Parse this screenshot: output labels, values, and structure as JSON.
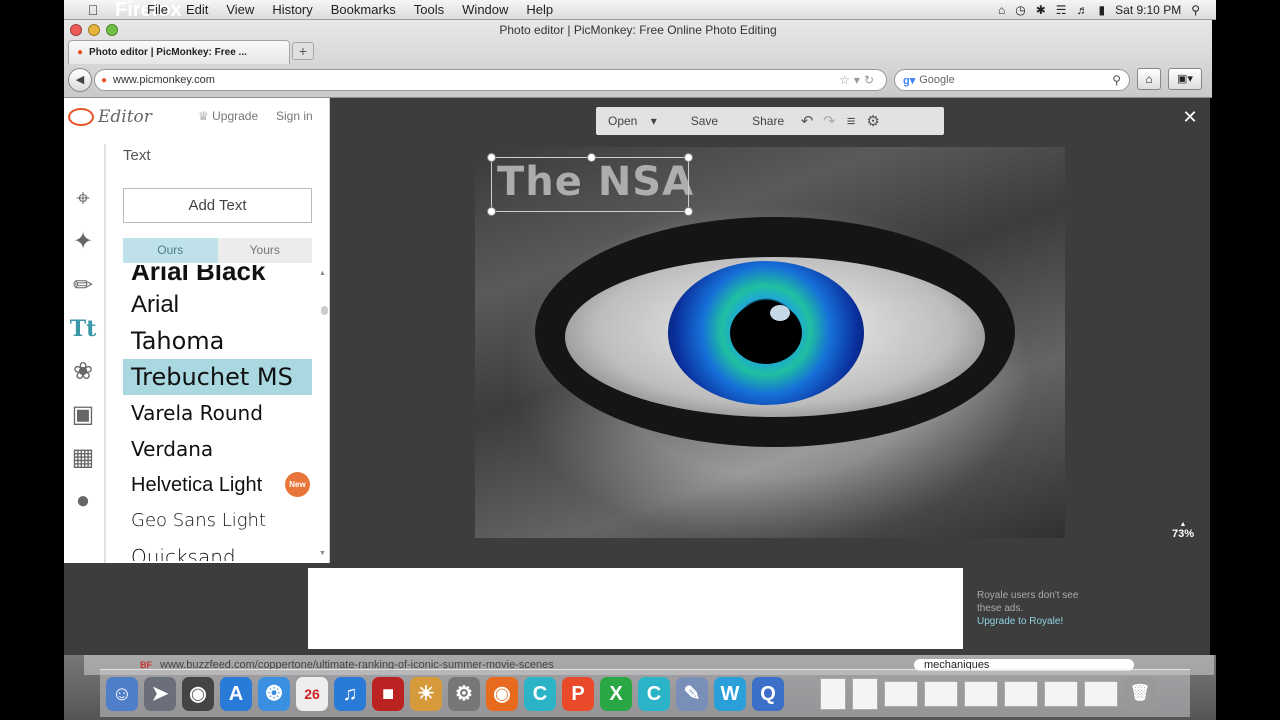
{
  "menubar": {
    "app": "Firefox",
    "items": [
      "File",
      "Edit",
      "View",
      "History",
      "Bookmarks",
      "Tools",
      "Window",
      "Help"
    ],
    "clock": "Sat 9:10 PM"
  },
  "browser": {
    "window_title": "Photo editor | PicMonkey: Free Online Photo Editing",
    "tab_title": "Photo editor | PicMonkey: Free ...",
    "url": "www.picmonkey.com",
    "search_placeholder": "Google"
  },
  "editor": {
    "logo_text": "Editor",
    "upgrade": "Upgrade",
    "signin": "Sign in",
    "panel_title": "Text",
    "add_text": "Add Text",
    "tabs": [
      "Ours",
      "Yours"
    ],
    "fonts": [
      {
        "name": "Arial Black",
        "css": "\"Liberation Sans\", sans-serif",
        "weight": "900"
      },
      {
        "name": "Arial",
        "css": "\"Liberation Sans\", sans-serif",
        "weight": "400"
      },
      {
        "name": "Tahoma",
        "css": "\"DejaVu Sans\", sans-serif",
        "weight": "400"
      },
      {
        "name": "Trebuchet MS",
        "css": "\"DejaVu Sans\", sans-serif",
        "weight": "400"
      },
      {
        "name": "Varela Round",
        "css": "\"DejaVu Sans\", sans-serif",
        "weight": "400"
      },
      {
        "name": "Verdana",
        "css": "\"DejaVu Sans\", sans-serif",
        "weight": "400"
      },
      {
        "name": "Helvetica Light",
        "css": "\"Liberation Sans\", sans-serif",
        "weight": "300"
      },
      {
        "name": "Geo Sans Light",
        "css": "\"DejaVu Sans\", sans-serif",
        "weight": "300"
      },
      {
        "name": "Quicksand",
        "css": "\"DejaVu Sans\", sans-serif",
        "weight": "300"
      }
    ],
    "selected_font": "Trebuchet MS",
    "new_badge": "New",
    "toolbar": {
      "open": "Open",
      "save": "Save",
      "share": "Share"
    },
    "overlay_text": "The NSA",
    "zoom": "73%",
    "ad_note": "Royale users don't see these ads.",
    "ad_link": "Upgrade to Royale!"
  },
  "background_window": {
    "url": "www.buzzfeed.com/coppertone/ultimate-ranking-of-iconic-summer-movie-scenes",
    "search": "mechaniques"
  },
  "dock": {
    "calendar_date": "26"
  },
  "colors": {
    "accent": "#3a97a8",
    "selected_row": "#a9d8e1",
    "badge": "#e8753a"
  }
}
